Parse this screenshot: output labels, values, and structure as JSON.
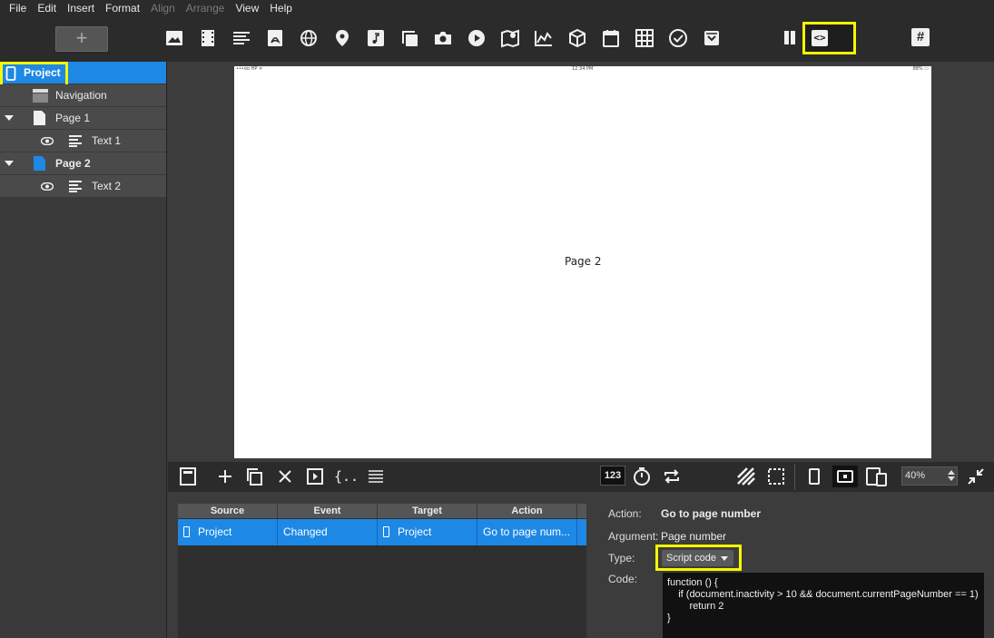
{
  "menu": [
    "File",
    "Edit",
    "Insert",
    "Format",
    "Align",
    "Arrange",
    "View",
    "Help"
  ],
  "menu_disabled": [
    "Align",
    "Arrange"
  ],
  "toolbar": {
    "add_label": "+",
    "insert_icons": [
      "image-icon",
      "video-film-icon",
      "text-icon",
      "pdf-icon",
      "web-globe-icon",
      "map-pin-icon",
      "music-icon",
      "gallery-icon",
      "camera-icon",
      "youtube-icon",
      "map-icon",
      "chart-icon",
      "3d-box-icon",
      "calendar-icon",
      "table-icon",
      "checkbox-icon",
      "archive-icon"
    ],
    "code_icon_label": "<>",
    "hash_icon_label": "#"
  },
  "sidebar": {
    "items": [
      {
        "label": "Project",
        "icon": "phone-icon",
        "selected": true
      },
      {
        "label": "Navigation",
        "icon": "navigation-icon"
      },
      {
        "label": "Page 1",
        "icon": "page-icon"
      },
      {
        "label": "Text 1",
        "icon": "text-icon"
      },
      {
        "label": "Page 2",
        "icon": "page-icon"
      },
      {
        "label": "Text 2",
        "icon": "text-icon"
      }
    ]
  },
  "canvas": {
    "status_left": "•••oo HP ᯤ",
    "status_center": "12:34 PM",
    "status_right": "88% ▭",
    "page_text": "Page 2"
  },
  "actionbar": {
    "counter_label": "123",
    "zoom": "40%"
  },
  "actions_table": {
    "headers": [
      "Source",
      "Event",
      "Target",
      "Action"
    ],
    "rows": [
      {
        "source": "Project",
        "event": "Changed",
        "target": "Project",
        "action": "Go to page num..."
      }
    ]
  },
  "properties": {
    "action_label": "Action:",
    "action_value": "Go to page number",
    "argument_label": "Argument:",
    "argument_value": "Page number",
    "type_label": "Type:",
    "type_value": "Script code",
    "code_label": "Code:",
    "code_lines": [
      "function () {",
      "    if (document.inactivity > 10 && document.currentPageNumber == 1)",
      "        return 2",
      "}"
    ]
  },
  "colors": {
    "accent": "#1e88e5",
    "highlight": "#f7f700",
    "background": "#3c3c3c",
    "toolbar": "#2b2b2b"
  }
}
